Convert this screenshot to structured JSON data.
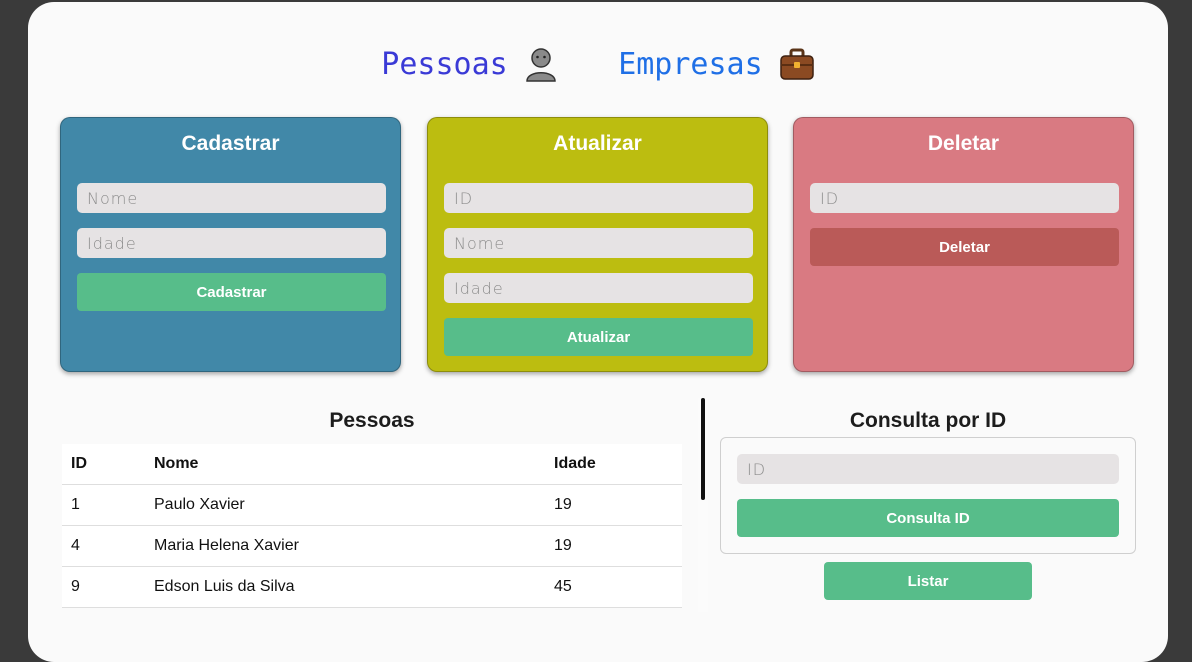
{
  "nav": {
    "pessoas_label": "Pessoas",
    "pessoas_icon": "person-emoji",
    "empresas_label": "Empresas",
    "empresas_icon": "briefcase-emoji"
  },
  "cadastrar": {
    "title": "Cadastrar",
    "nome_placeholder": "Nome",
    "idade_placeholder": "Idade",
    "button": "Cadastrar"
  },
  "atualizar": {
    "title": "Atualizar",
    "id_placeholder": "ID",
    "nome_placeholder": "Nome",
    "idade_placeholder": "Idade",
    "button": "Atualizar"
  },
  "deletar": {
    "title": "Deletar",
    "id_placeholder": "ID",
    "button": "Deletar"
  },
  "pessoas_table": {
    "title": "Pessoas",
    "headers": [
      "ID",
      "Nome",
      "Idade"
    ],
    "rows": [
      [
        "1",
        "Paulo Xavier",
        "19"
      ],
      [
        "4",
        "Maria Helena Xavier",
        "19"
      ],
      [
        "9",
        "Edson Luis da Silva",
        "45"
      ]
    ]
  },
  "consulta": {
    "title": "Consulta por ID",
    "id_placeholder": "ID",
    "button": "Consulta ID",
    "listar_button": "Listar"
  },
  "colors": {
    "cadastrar_card": "#4188a8",
    "atualizar_card": "#bcbd10",
    "deletar_card": "#d97a82",
    "deletar_button": "#ba5a58",
    "primary_button": "#57bd8a"
  }
}
